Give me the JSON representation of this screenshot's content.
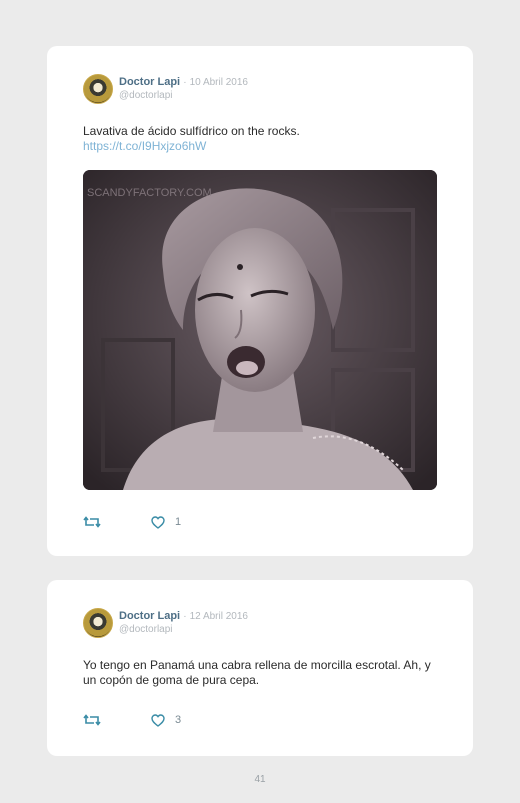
{
  "tweets": [
    {
      "name": "Doctor Lapi",
      "separator": "·",
      "date": "10 Abril 2016",
      "handle": "@doctorlapi",
      "text": "Lavativa de ácido sulfídrico on the rocks.",
      "link": "https://t.co/I9Hxjzo6hW",
      "media": {
        "watermark": "SCANDYFACTORY.COM"
      },
      "like_count": "1"
    },
    {
      "name": "Doctor Lapi",
      "separator": "·",
      "date": "12 Abril 2016",
      "handle": "@doctorlapi",
      "text": "Yo tengo en Panamá una cabra rellena de morcilla escrotal. Ah, y un copón de goma de pura cepa.",
      "like_count": "3"
    }
  ],
  "page_number": "41",
  "colors": {
    "background": "#ebebeb",
    "card": "#ffffff",
    "name": "#4e6f86",
    "muted": "#b3b8bd",
    "link": "#7fb3d5",
    "icon": "#3a8ca6"
  },
  "icons": [
    "retweet-icon",
    "heart-icon"
  ]
}
